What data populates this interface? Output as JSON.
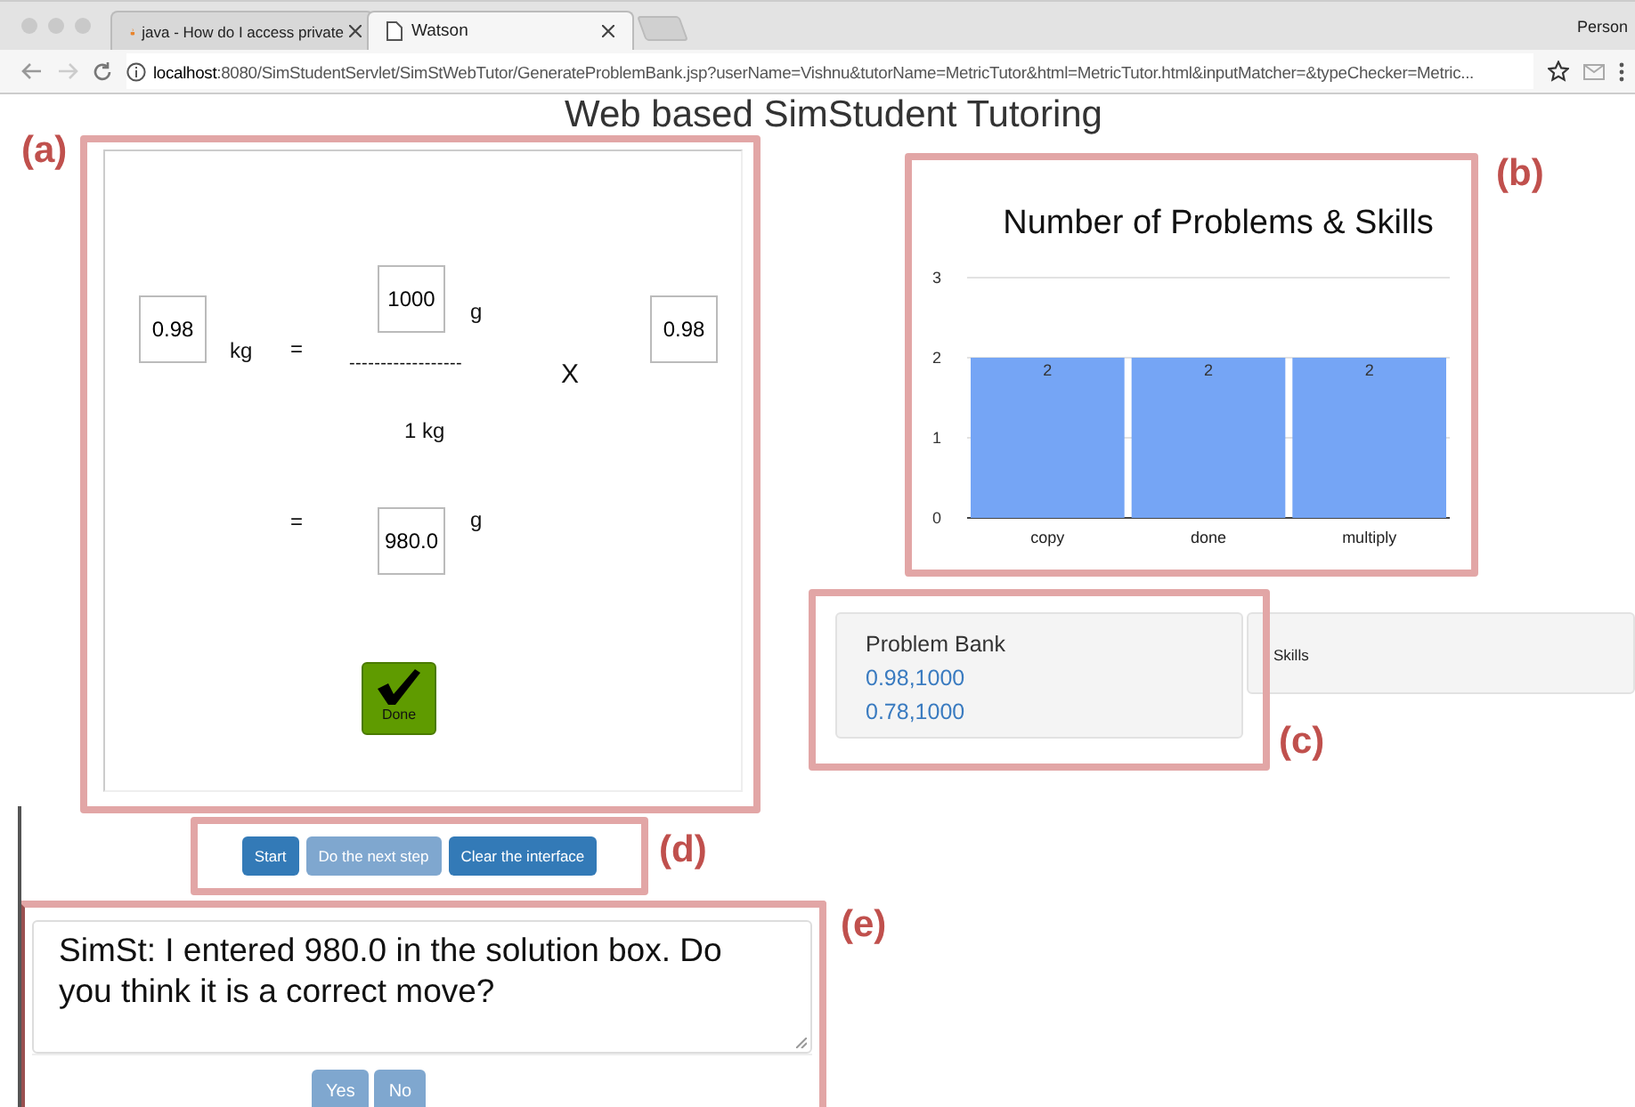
{
  "browser": {
    "tabs": [
      {
        "title": "java - How do I access private",
        "selected": false
      },
      {
        "title": "Watson",
        "selected": true
      }
    ],
    "profile": "Person",
    "url_host": "localhost",
    "url_rest": ":8080/SimStudentServlet/SimStWebTutor/GenerateProblemBank.jsp?userName=Vishnu&tutorName=MetricTutor&html=MetricTutor.html&inputMatcher=&typeChecker=Metric..."
  },
  "page": {
    "title": "Web based SimStudent Tutoring"
  },
  "annotations": [
    "(a)",
    "(b)",
    "(c)",
    "(d)",
    "(e)"
  ],
  "tutor": {
    "given_value": "0.98",
    "given_unit": "kg",
    "equals_1": "=",
    "numerator": "1000",
    "numerator_unit": "g",
    "fraction_bar": "------------------",
    "denominator": "1 kg",
    "times": "X",
    "multiplier": "0.98",
    "equals_2": "=",
    "answer": "980.0",
    "answer_unit": "g",
    "done_label": "Done"
  },
  "chart": {
    "chart_data": {
      "type": "bar",
      "title": "Number of Problems & Skills",
      "categories": [
        "copy",
        "done",
        "multiply"
      ],
      "series": [
        {
          "color": "#75a5f5",
          "values": [
            2,
            2,
            2
          ]
        }
      ],
      "ylim": [
        0,
        3
      ],
      "yticks": [
        0,
        1,
        2,
        3
      ],
      "data_labels": true
    }
  },
  "problem_bank": {
    "title": "Problem Bank",
    "items": [
      "0.98,1000",
      "0.78,1000"
    ]
  },
  "skills": {
    "title": "Skills"
  },
  "controls": [
    {
      "label": "Start",
      "disabled": false
    },
    {
      "label": "Do the next step",
      "disabled": true
    },
    {
      "label": "Clear the interface",
      "disabled": false
    }
  ],
  "chat": {
    "message": "SimSt: I entered 980.0 in the solution box. Do you think it is a correct move?",
    "buttons": [
      "Yes",
      "No"
    ]
  }
}
